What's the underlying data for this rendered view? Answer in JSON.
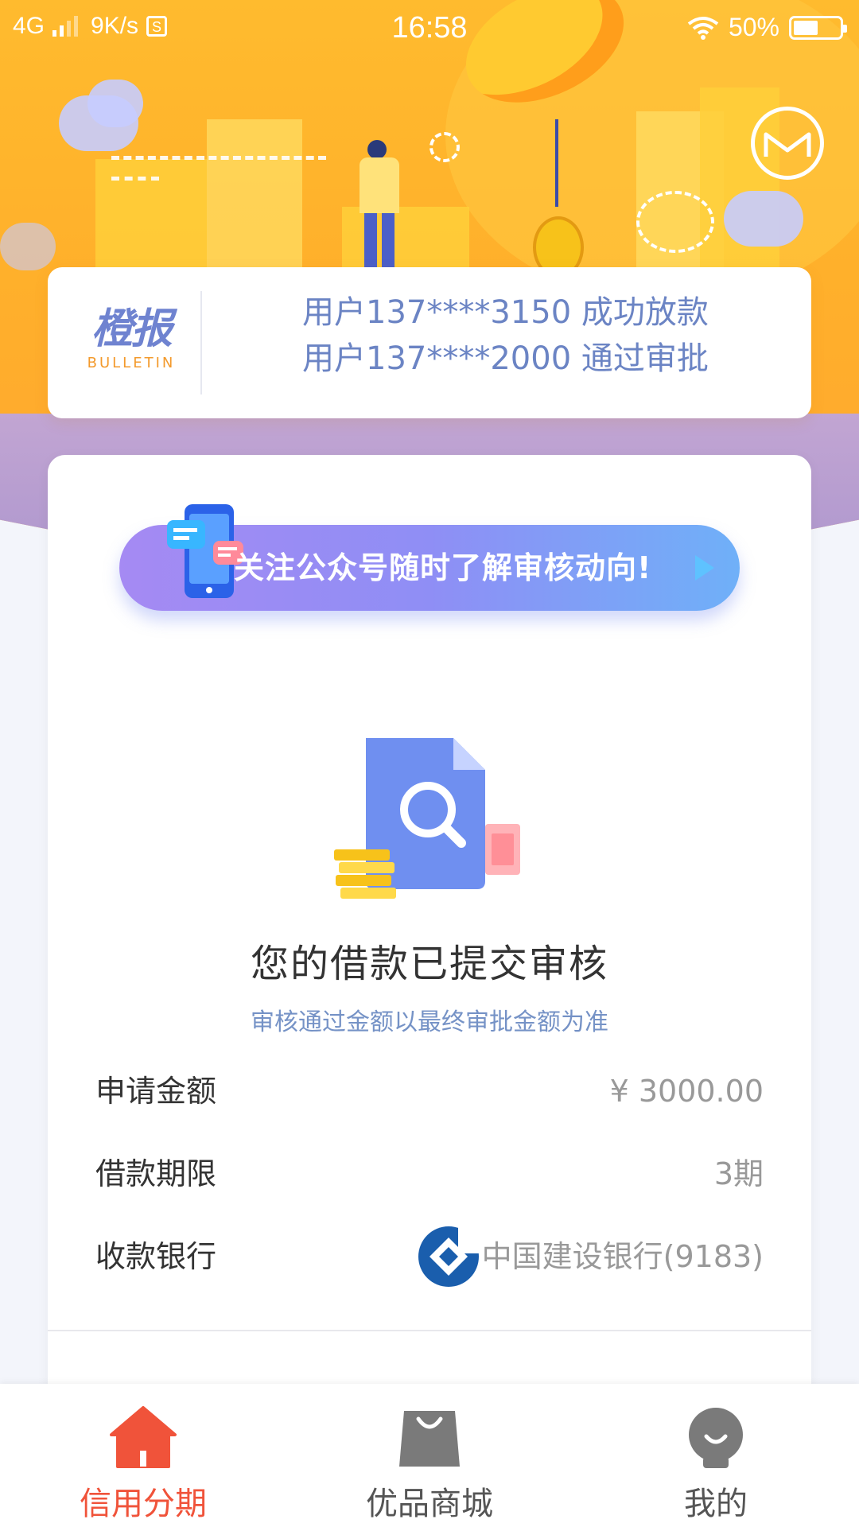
{
  "status_bar": {
    "network": "4G",
    "speed": "9K/s",
    "sim_icon": "S",
    "time": "16:58",
    "battery": "50%",
    "battery_level": 0.5
  },
  "header": {
    "message_icon": "message-envelope-icon"
  },
  "bulletin": {
    "logo_cn": "橙报",
    "logo_en": "BULLETIN",
    "items": [
      "用户137****3150 成功放款",
      "用户137****2000 通过审批"
    ]
  },
  "banner": {
    "text": "关注公众号随时了解审核动向!"
  },
  "status": {
    "title": "您的借款已提交审核",
    "subtitle": "审核通过金额以最终审批金额为准"
  },
  "details": [
    {
      "label": "申请金额",
      "value": "¥ 3000.00"
    },
    {
      "label": "借款期限",
      "value": "3期"
    },
    {
      "label": "收款银行",
      "value": "中国建设银行(9183)"
    }
  ],
  "tabs": [
    {
      "label": "信用分期",
      "icon": "home-icon",
      "active": true
    },
    {
      "label": "优品商城",
      "icon": "shopping-bag-icon",
      "active": false
    },
    {
      "label": "我的",
      "icon": "profile-icon",
      "active": false
    }
  ],
  "colors": {
    "accent": "#f0533a",
    "hero": "#ffb02b",
    "link_blue": "#6b84c4"
  }
}
